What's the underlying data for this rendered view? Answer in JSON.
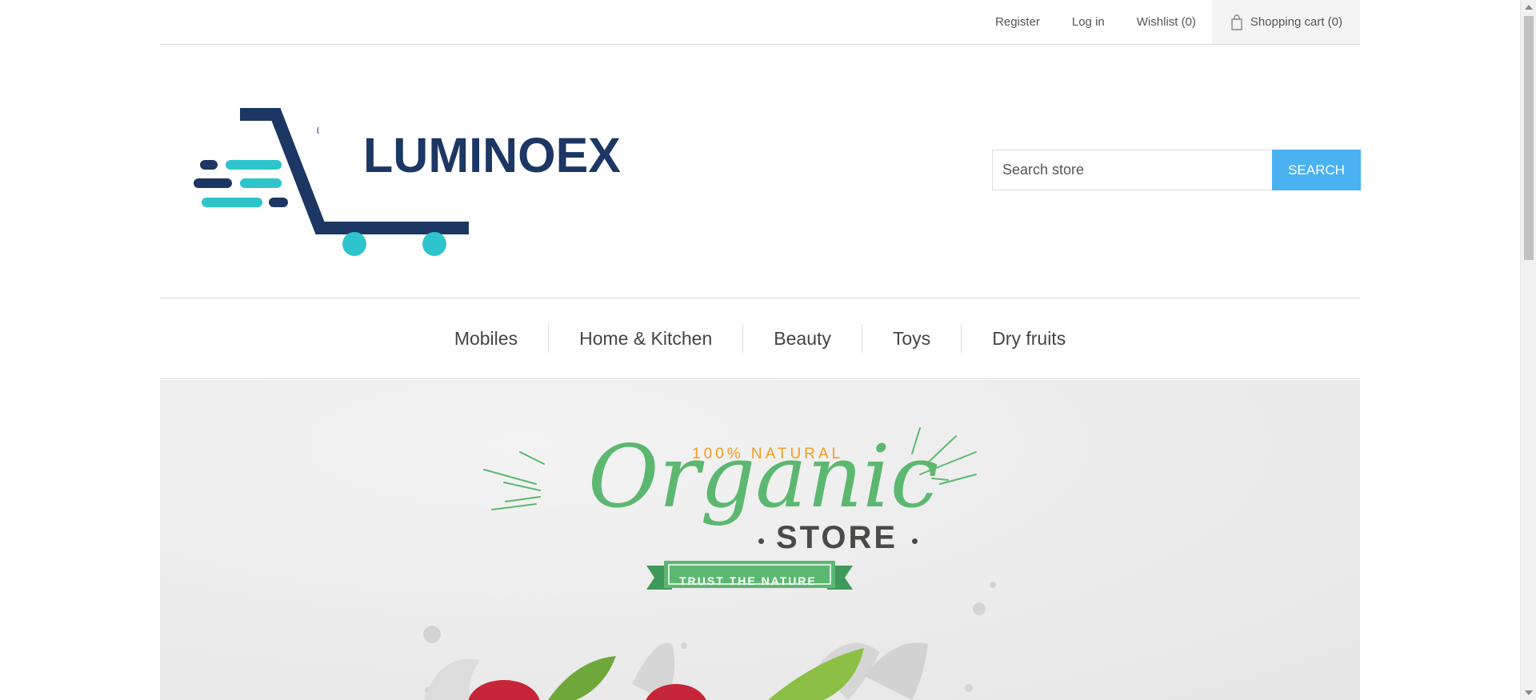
{
  "header": {
    "links": {
      "register": "Register",
      "login": "Log in",
      "wishlist": "Wishlist (0)",
      "cart": "Shopping cart (0)"
    }
  },
  "logo": {
    "text": "LUMINOEX"
  },
  "search": {
    "placeholder": "Search store",
    "button_label": "SEARCH"
  },
  "menu": {
    "items": [
      {
        "label": "Mobiles"
      },
      {
        "label": "Home & Kitchen"
      },
      {
        "label": "Beauty"
      },
      {
        "label": "Toys"
      },
      {
        "label": "Dry fruits"
      }
    ]
  },
  "banner": {
    "tagline": "100% NATURAL",
    "title": "Organic",
    "subtitle": "STORE",
    "ribbon": "TRUST THE NATURE"
  },
  "colors": {
    "accent": "#4ab2f1",
    "logo_navy": "#1c3763",
    "logo_teal": "#2ec4cc",
    "organic_green": "#5cb870",
    "natural_orange": "#f49c20"
  },
  "icons": {
    "cart": "shopping-bag-icon"
  }
}
